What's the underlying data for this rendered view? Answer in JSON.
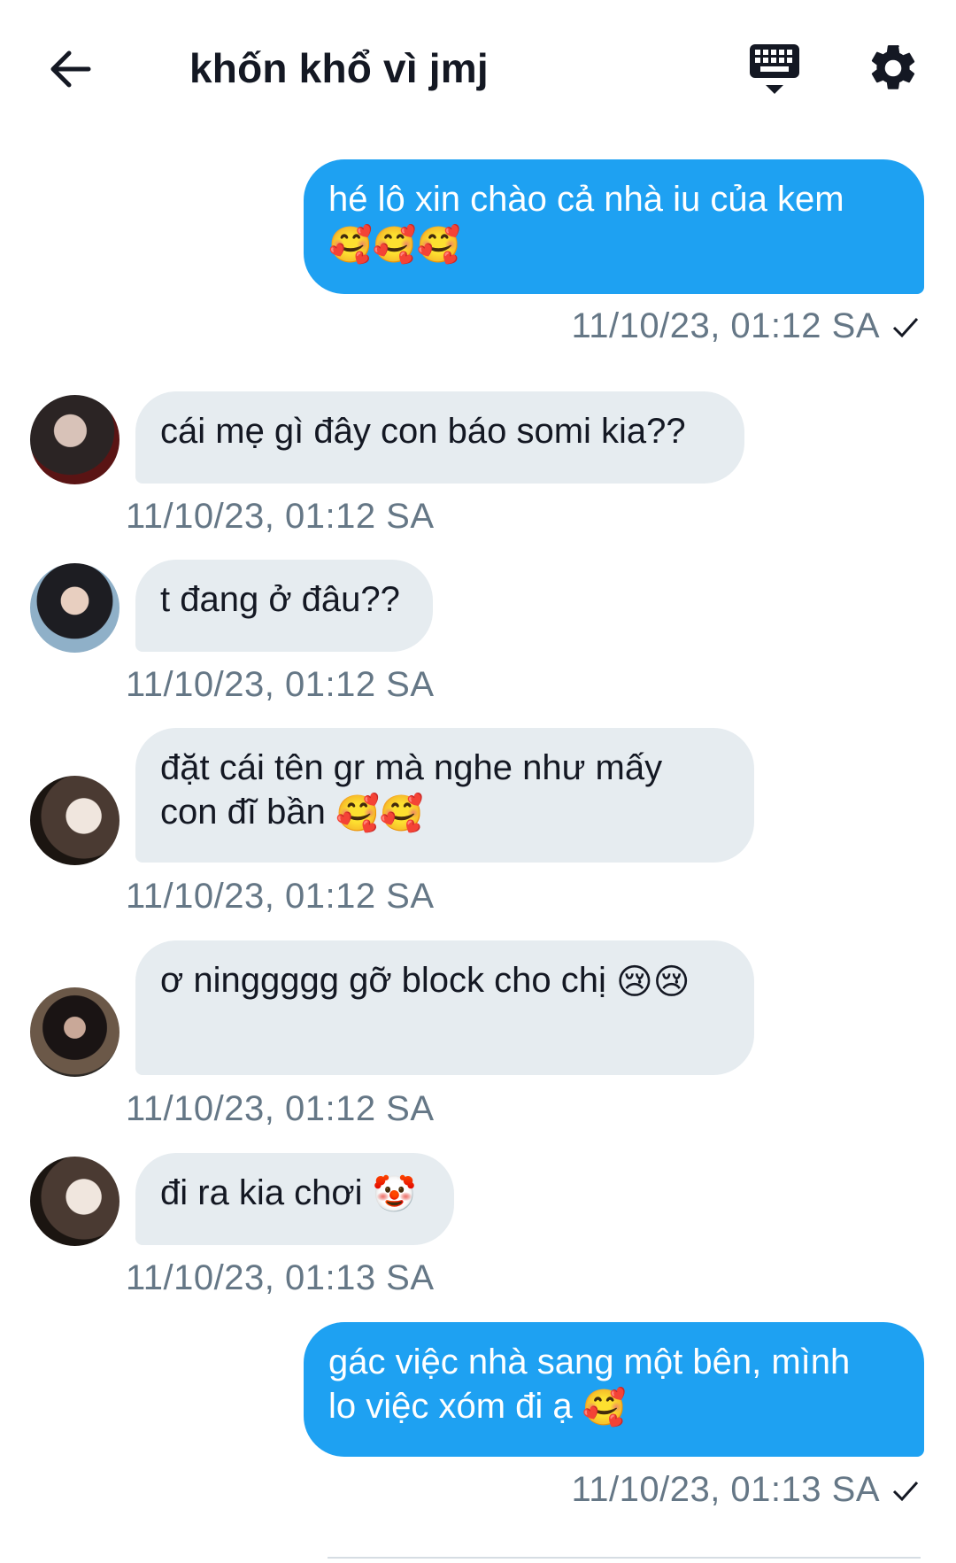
{
  "header": {
    "title": "khốn khổ vì jmj",
    "back_icon": "arrow-left-icon",
    "keyboard_icon": "keyboard-icon",
    "settings_icon": "gear-icon"
  },
  "colors": {
    "outgoing_bubble": "#1ea1f2",
    "incoming_bubble": "#e6ecf0",
    "timestamp": "#657786",
    "title": "#141823"
  },
  "messages": [
    {
      "direction": "outgoing",
      "text": "hé lô xin chào cả nhà iu của kem",
      "emojis": "🥰🥰🥰",
      "time": "11/10/23, 01:12 SA",
      "status_icon": "check-icon"
    },
    {
      "direction": "incoming",
      "text": "cái mẹ gì đây con báo somi kia??",
      "time": "11/10/23, 01:12 SA",
      "avatar": "avatar-1"
    },
    {
      "direction": "incoming",
      "text": "t đang ở đâu??",
      "time": "11/10/23, 01:12 SA",
      "avatar": "avatar-2"
    },
    {
      "direction": "incoming",
      "text_line1": "đặt cái tên gr mà nghe như mấy",
      "text_line2": "con đĩ bần",
      "emojis": "🥰🥰",
      "time": "11/10/23, 01:12 SA",
      "avatar": "avatar-3"
    },
    {
      "direction": "incoming",
      "text": "ơ ninggggg gỡ block cho chị",
      "emojis": "😢😢",
      "time": "11/10/23, 01:12 SA",
      "avatar": "avatar-4"
    },
    {
      "direction": "incoming",
      "text": "đi ra kia chơi",
      "emojis": "🤡",
      "time": "11/10/23, 01:13 SA",
      "avatar": "avatar-3"
    },
    {
      "direction": "outgoing",
      "text_line1": "gác việc nhà sang một bên, mình",
      "text_line2": "lo việc xóm đi ạ",
      "emojis": "🥰",
      "time": "11/10/23, 01:13 SA",
      "status_icon": "check-icon"
    }
  ]
}
